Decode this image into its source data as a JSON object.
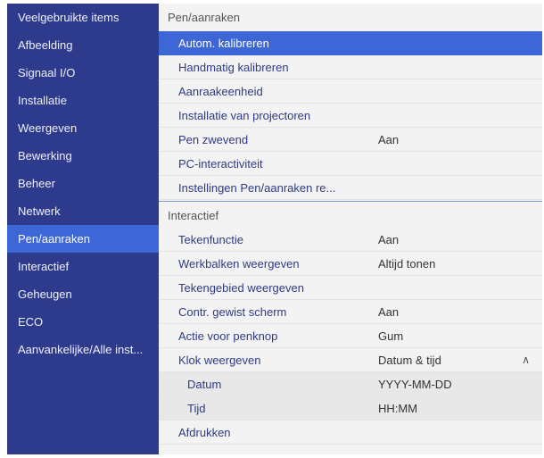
{
  "sidebar": {
    "items": [
      {
        "label": "Veelgebruikte items"
      },
      {
        "label": "Afbeelding"
      },
      {
        "label": "Signaal I/O"
      },
      {
        "label": "Installatie"
      },
      {
        "label": "Weergeven"
      },
      {
        "label": "Bewerking"
      },
      {
        "label": "Beheer"
      },
      {
        "label": "Netwerk"
      },
      {
        "label": "Pen/aanraken",
        "selected": true
      },
      {
        "label": "Interactief"
      },
      {
        "label": "Geheugen"
      },
      {
        "label": "ECO"
      },
      {
        "label": "Aanvankelijke/Alle inst..."
      }
    ]
  },
  "main": {
    "section1": {
      "header": "Pen/aanraken",
      "rows": [
        {
          "label": "Autom. kalibreren",
          "value": "",
          "selected": true
        },
        {
          "label": "Handmatig kalibreren",
          "value": ""
        },
        {
          "label": "Aanraakeenheid",
          "value": ""
        },
        {
          "label": "Installatie van projectoren",
          "value": ""
        },
        {
          "label": "Pen zwevend",
          "value": "Aan"
        },
        {
          "label": "PC-interactiviteit",
          "value": ""
        },
        {
          "label": "Instellingen Pen/aanraken re...",
          "value": ""
        }
      ]
    },
    "section2": {
      "header": "Interactief",
      "rows": [
        {
          "label": "Tekenfunctie",
          "value": "Aan"
        },
        {
          "label": "Werkbalken weergeven",
          "value": "Altijd tonen"
        },
        {
          "label": "Tekengebied weergeven",
          "value": ""
        },
        {
          "label": "Contr. gewist scherm",
          "value": "Aan"
        },
        {
          "label": "Actie voor penknop",
          "value": "Gum"
        },
        {
          "label": "Klok weergeven",
          "value": "Datum & tijd",
          "icon": "chevron-up-icon"
        },
        {
          "label": "Datum",
          "value": "YYYY-MM-DD",
          "sub": true
        },
        {
          "label": "Tijd",
          "value": "HH:MM",
          "sub": true
        },
        {
          "label": "Afdrukken",
          "value": ""
        }
      ]
    }
  },
  "colors": {
    "sidebar_bg": "#2e3a8c",
    "selected_bg": "#3d67d6",
    "row_text": "#2f3b84",
    "panel_bg": "#f3f3f3"
  }
}
